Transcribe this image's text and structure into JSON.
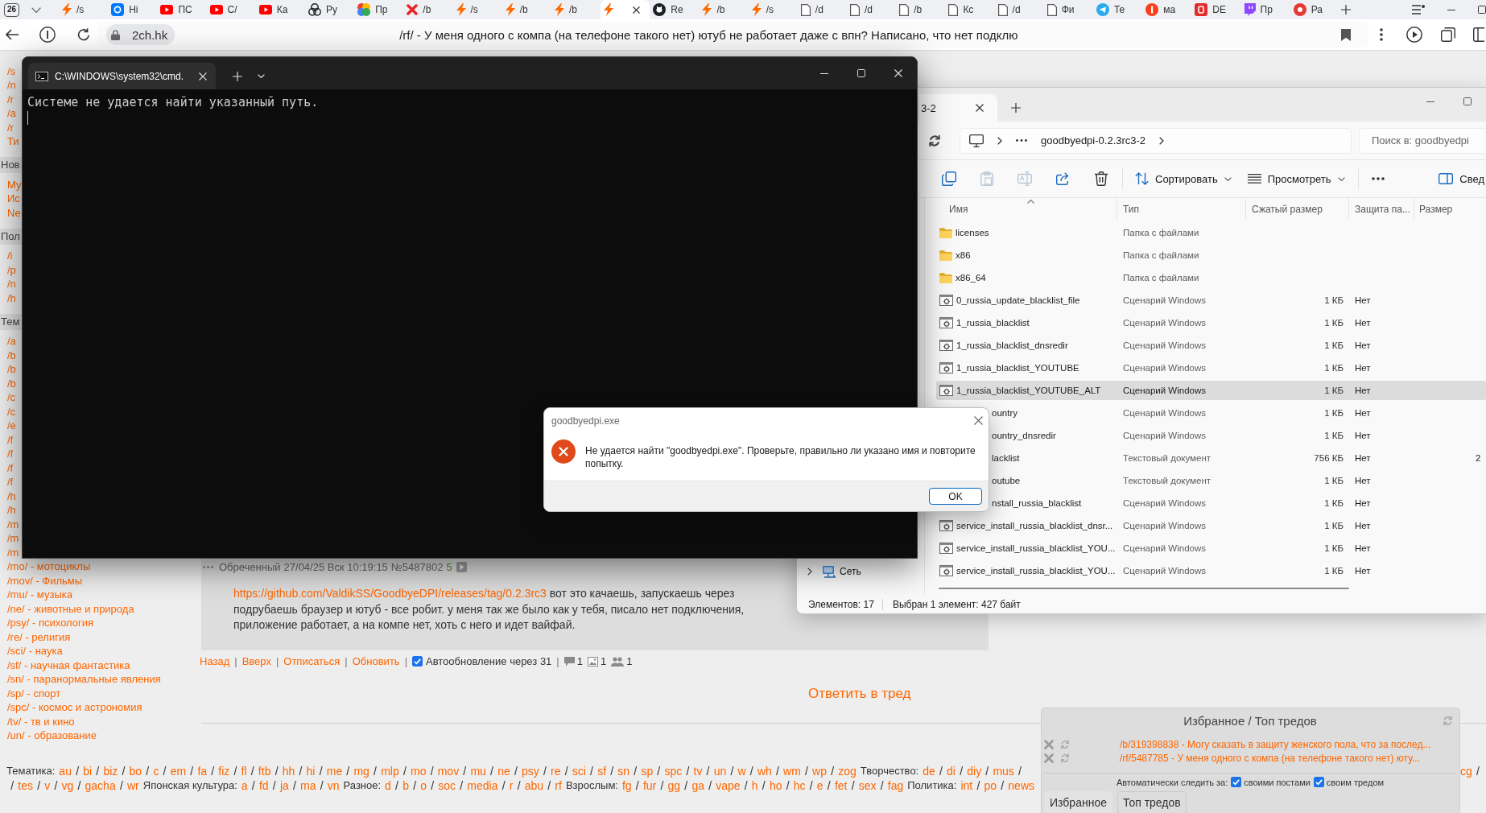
{
  "browser": {
    "tab_count": "26",
    "tabs": [
      {
        "kind": "bolt",
        "title": "/s",
        "selected": false
      },
      {
        "kind": "tile",
        "title": "Hi",
        "selected": false
      },
      {
        "kind": "play",
        "title": "ПС",
        "selected": false
      },
      {
        "kind": "play",
        "title": "С/",
        "selected": false
      },
      {
        "kind": "play",
        "title": "Ка",
        "selected": false
      },
      {
        "kind": "knot",
        "title": "Ру",
        "selected": false
      },
      {
        "kind": "petals",
        "title": "Пр",
        "selected": false
      },
      {
        "kind": "cross",
        "title": "/b",
        "selected": false
      },
      {
        "kind": "bolt",
        "title": "/s",
        "selected": false
      },
      {
        "kind": "bolt",
        "title": "/b",
        "selected": false
      },
      {
        "kind": "bolt",
        "title": "/b",
        "selected": false
      },
      {
        "kind": "bolt",
        "selected": true
      },
      {
        "kind": "octo",
        "title": "Re",
        "selected": false
      },
      {
        "kind": "bolt",
        "title": "/b",
        "selected": false
      },
      {
        "kind": "bolt",
        "title": "/s",
        "selected": false
      },
      {
        "kind": "page",
        "title": "/d",
        "selected": false
      },
      {
        "kind": "page",
        "title": "/d",
        "selected": false
      },
      {
        "kind": "page",
        "title": "/b",
        "selected": false
      },
      {
        "kind": "page",
        "title": "Кс",
        "selected": false
      },
      {
        "kind": "page",
        "title": "/d",
        "selected": false
      },
      {
        "kind": "page",
        "title": "Фи",
        "selected": false
      },
      {
        "kind": "plane",
        "title": "Те",
        "selected": false
      },
      {
        "kind": "glyph",
        "title": "ма",
        "selected": false
      },
      {
        "kind": "block",
        "title": "DE",
        "selected": false
      },
      {
        "kind": "bubble",
        "title": "Пр",
        "selected": false
      },
      {
        "kind": "disc",
        "title": "Ра",
        "selected": false
      }
    ],
    "address": "2ch.hk",
    "page_title": "/rf/ - У меня одного с компа (на телефоне такого нет) ютуб не работает даже с впн? Написано, что нет подклю"
  },
  "page": {
    "sidebar": [
      {
        "items": [
          "/s",
          "/n",
          "/r",
          "/a",
          "/r",
          "Ти"
        ]
      },
      {
        "title": "Нов",
        "items": [
          "Му",
          "Ис",
          "Ne"
        ]
      },
      {
        "title": "Пол",
        "items": [
          "/i",
          "/p",
          "/n",
          "/h"
        ]
      },
      {
        "title": "Тем",
        "items": [
          "/a",
          "/b",
          "/b",
          "/b",
          "/c",
          "/c",
          "/e",
          "/f",
          "/f",
          "/f",
          "/f",
          "/h",
          "/h",
          "/m",
          "/m",
          "/m",
          "/mo/ - мотоциклы",
          "/mov/ - Фильмы",
          "/mu/ - музыка",
          "/ne/ - животные и природа",
          "/psy/ - психология",
          "/re/ - религия",
          "/sci/ - наука",
          "/sf/ - научная фантастика",
          "/sn/ - паранормальные явления",
          "/sp/ - спорт",
          "/spc/ - космос и астрономия",
          "/tv/ - тв и кино",
          "/un/ - образование"
        ]
      }
    ],
    "post": {
      "author": "Обреченный",
      "date": "27/04/25 Вск 10:19:15",
      "number": "№5487802",
      "ordinal": "5",
      "link": "https://github.com/ValdikSS/GoodbyeDPI/releases/tag/0.2.3rc3",
      "lines": [
        "вот это качаешь, запускаешь через",
        "подрубаешь браузер и ютуб - все робит. у меня так же было как у тебя, писало нет подключения,",
        "приложение работает, а на компе нет, хоть с него и идет вайфай."
      ]
    },
    "thread_nav": {
      "separator": "|",
      "links": [
        "Назад",
        "Вверх",
        "Отписаться",
        "Обновить"
      ],
      "autoupdate": {
        "label": "Автообновление через 31",
        "checked": true
      },
      "stats": [
        {
          "kind": "posts",
          "count": "1"
        },
        {
          "kind": "images",
          "count": "1"
        },
        {
          "kind": "posters",
          "count": "1"
        }
      ]
    },
    "reply_link": "Ответить в тред",
    "footer": {
      "separator": "/",
      "lines": [
        {
          "groups": [
            {
              "label": "Тематика:",
              "links": [
                "au",
                "bi",
                "biz",
                "bo",
                "c",
                "em",
                "fa",
                "fiz",
                "fl",
                "ftb",
                "hh",
                "hi",
                "me",
                "mg",
                "mlp",
                "mo",
                "mov",
                "mu",
                "ne",
                "psy",
                "re",
                "sci",
                "sf",
                "sn",
                "sp",
                "spc",
                "tv",
                "un",
                "w",
                "wh",
                "wm",
                "wp",
                "zog"
              ]
            },
            {
              "label": "Творчество:",
              "links": [
                "de",
                "di",
                "diy",
                "mus"
              ],
              "trailing": true
            }
          ],
          "tail": {
            "links": [
              "cg"
            ],
            "trailing": true
          }
        },
        {
          "groups": [
            {
              "leading": true,
              "links": [
                "tes",
                "v",
                "vg",
                "gacha",
                "wr"
              ]
            },
            {
              "label": "Японская культура:",
              "links": [
                "a",
                "fd",
                "ja",
                "ma",
                "vn"
              ]
            },
            {
              "label": "Разное:",
              "links": [
                "d",
                "b",
                "o",
                "soc",
                "media",
                "r",
                "abu",
                "rf"
              ]
            },
            {
              "label": "Взрослым:",
              "links": [
                "fg",
                "fur",
                "gg",
                "ga",
                "vape",
                "h",
                "ho",
                "hc",
                "e",
                "fet",
                "sex",
                "fag"
              ]
            },
            {
              "label": "Политика:",
              "links": [
                "int",
                "po",
                "news"
              ]
            }
          ]
        }
      ]
    }
  },
  "favorites": {
    "title": "Избранное / Топ тредов",
    "threads": [
      "/b/319398838 - Могу сказать в защиту женского пола, что за послед...",
      "/rf/5487785 - У меня одного с компа (на телефоне такого нет) юту..."
    ],
    "follow_label": "Автоматически следить за:",
    "follow": [
      {
        "label": "своими постами",
        "checked": true
      },
      {
        "label": "своим тредом",
        "checked": true
      }
    ],
    "tabs": [
      {
        "label": "Избранное",
        "selected": true
      },
      {
        "label": "Топ тредов",
        "selected": false
      }
    ]
  },
  "explorer": {
    "tab_title": "3-2",
    "path": "goodbyedpi-0.2.3rc3-2",
    "search_placeholder": "Поиск в: goodbyedpi",
    "toolbar": {
      "actions": [
        {
          "kind": "copy",
          "disabled": false
        },
        {
          "kind": "paste",
          "disabled": true
        },
        {
          "kind": "rename",
          "disabled": true
        },
        {
          "kind": "share",
          "disabled": false
        },
        {
          "kind": "delete",
          "disabled": false
        }
      ],
      "sort": "Сортировать",
      "view": "Просмотреть",
      "details": "Свед"
    },
    "columns": [
      "Имя",
      "Тип",
      "Сжатый размер",
      "Защита па...",
      "Размер"
    ],
    "rows": [
      {
        "kind": "folder",
        "name": "licenses",
        "type": "Папка с файлами",
        "selected": false
      },
      {
        "kind": "folder",
        "name": "x86",
        "type": "Папка с файлами",
        "selected": false
      },
      {
        "kind": "folder",
        "name": "x86_64",
        "type": "Папка с файлами",
        "selected": false
      },
      {
        "kind": "script",
        "name": "0_russia_update_blacklist_file",
        "type": "Сценарий Windows",
        "packed": "1 КБ",
        "protected": "Нет",
        "selected": false
      },
      {
        "kind": "script",
        "name": "1_russia_blacklist",
        "type": "Сценарий Windows",
        "packed": "1 КБ",
        "protected": "Нет",
        "selected": false
      },
      {
        "kind": "script",
        "name": "1_russia_blacklist_dnsredir",
        "type": "Сценарий Windows",
        "packed": "1 КБ",
        "protected": "Нет",
        "selected": false
      },
      {
        "kind": "script",
        "name": "1_russia_blacklist_YOUTUBE",
        "type": "Сценарий Windows",
        "packed": "1 КБ",
        "protected": "Нет",
        "selected": false
      },
      {
        "kind": "script",
        "name": "1_russia_blacklist_YOUTUBE_ALT",
        "type": "Сценарий Windows",
        "packed": "1 КБ",
        "protected": "Нет",
        "selected": true
      },
      {
        "kind": "covered",
        "name": "ountry",
        "type": "Сценарий Windows",
        "packed": "1 КБ",
        "protected": "Нет",
        "selected": false
      },
      {
        "kind": "covered",
        "name": "ountry_dnsredir",
        "type": "Сценарий Windows",
        "packed": "1 КБ",
        "protected": "Нет",
        "selected": false
      },
      {
        "kind": "covered",
        "name": "lacklist",
        "type": "Текстовый документ",
        "packed": "756 КБ",
        "protected": "Нет",
        "size": "2",
        "selected": false
      },
      {
        "kind": "covered",
        "name": "outube",
        "type": "Текстовый документ",
        "packed": "1 КБ",
        "protected": "Нет",
        "selected": false
      },
      {
        "kind": "covered",
        "name": "nstall_russia_blacklist",
        "type": "Сценарий Windows",
        "packed": "1 КБ",
        "protected": "Нет",
        "selected": false
      },
      {
        "kind": "script",
        "name": "service_install_russia_blacklist_dnsr...",
        "type": "Сценарий Windows",
        "packed": "1 КБ",
        "protected": "Нет",
        "selected": false
      },
      {
        "kind": "script",
        "name": "service_install_russia_blacklist_YOU...",
        "type": "Сценарий Windows",
        "packed": "1 КБ",
        "protected": "Нет",
        "selected": false
      },
      {
        "kind": "script",
        "name": "service_install_russia_blacklist_YOU...",
        "type": "Сценарий Windows",
        "packed": "1 КБ",
        "protected": "Нет",
        "selected": false
      }
    ],
    "nav": [
      {
        "label": "Сеть"
      }
    ],
    "status": [
      "Элементов: 17",
      "Выбран 1 элемент: 427 байт"
    ]
  },
  "terminal": {
    "tab_title": "C:\\WINDOWS\\system32\\cmd.",
    "lines": [
      "Системе не удается найти указанный путь."
    ]
  },
  "dialog": {
    "title": "goodbyedpi.exe",
    "message": "Не удается найти \"goodbyedpi.exe\". Проверьте, правильно ли указано имя и повторите попытку.",
    "button": "OK"
  }
}
